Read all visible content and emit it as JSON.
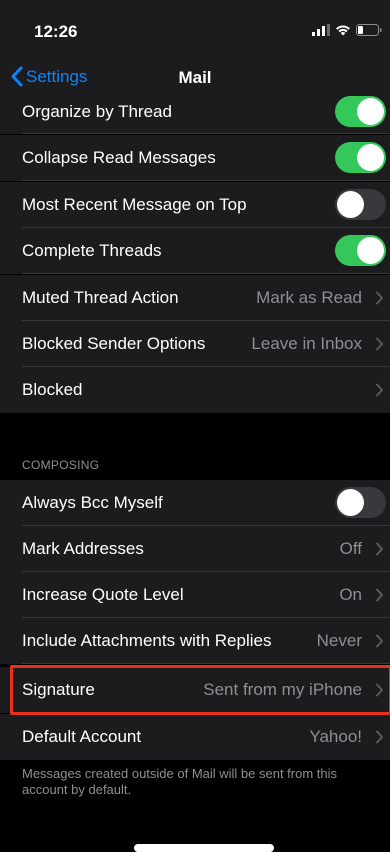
{
  "status_bar": {
    "time": "12:26"
  },
  "nav": {
    "back_label": "Settings",
    "title": "Mail"
  },
  "threading_rows": [
    {
      "label": "Organize by Thread",
      "type": "toggle",
      "on": true
    },
    {
      "label": "Collapse Read Messages",
      "type": "toggle",
      "on": true
    },
    {
      "label": "Most Recent Message on Top",
      "type": "toggle",
      "on": false
    },
    {
      "label": "Complete Threads",
      "type": "toggle",
      "on": true
    },
    {
      "label": "Muted Thread Action",
      "type": "disclosure",
      "value": "Mark as Read"
    },
    {
      "label": "Blocked Sender Options",
      "type": "disclosure",
      "value": "Leave in Inbox"
    },
    {
      "label": "Blocked",
      "type": "disclosure",
      "value": ""
    }
  ],
  "composing": {
    "header": "COMPOSING",
    "rows": [
      {
        "label": "Always Bcc Myself",
        "type": "toggle",
        "on": false
      },
      {
        "label": "Mark Addresses",
        "type": "disclosure",
        "value": "Off"
      },
      {
        "label": "Increase Quote Level",
        "type": "disclosure",
        "value": "On"
      },
      {
        "label": "Include Attachments with Replies",
        "type": "disclosure",
        "value": "Never"
      },
      {
        "label": "Signature",
        "type": "disclosure",
        "value": "Sent from my iPhone"
      },
      {
        "label": "Default Account",
        "type": "disclosure",
        "value": "Yahoo!"
      }
    ],
    "footer": "Messages created outside of Mail will be sent from this account by default."
  },
  "colors": {
    "accent": "#0a84ff",
    "toggle_on": "#34c759",
    "highlight": "#e8311c",
    "row_background": "#1c1c1e"
  }
}
